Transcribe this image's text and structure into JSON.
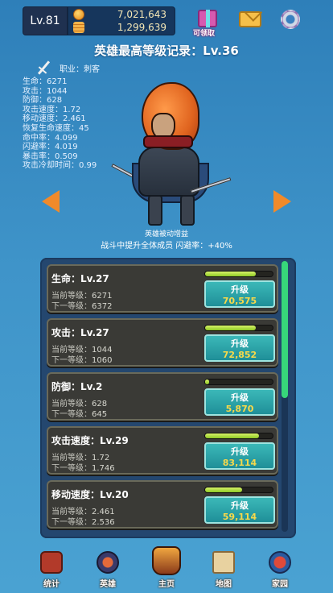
{
  "header": {
    "level": "Lv.81",
    "gold": "7,021,643",
    "gems": "1,299,639",
    "gift_label": "可领取"
  },
  "hero": {
    "record_title": "英雄最高等级记录：Lv.36",
    "job": "职业：刺客",
    "stats": [
      "生命：6271",
      "攻击：1044",
      "防御：628",
      "攻击速度：1.72",
      "移动速度：2.461",
      "恢复生命速度：45",
      "命中率：4.099",
      "闪避率：4.019",
      "暴击率：0.509",
      "攻击冷却时间：0.99"
    ],
    "passive_title": "英雄被动增益",
    "passive_desc": "战斗中提升全体成员 闪避率：+40%"
  },
  "upgrades": [
    {
      "name": "生命：Lv.27",
      "cur_label": "当前等级：",
      "cur": "6271",
      "next_label": "下一等级：",
      "next": "6372",
      "btn": "升级",
      "cost": "70,575",
      "progress": 0.75
    },
    {
      "name": "攻击：Lv.27",
      "cur_label": "当前等级：",
      "cur": "1044",
      "next_label": "下一等级：",
      "next": "1060",
      "btn": "升级",
      "cost": "72,852",
      "progress": 0.75
    },
    {
      "name": "防御：Lv.2",
      "cur_label": "当前等级：",
      "cur": "628",
      "next_label": "下一等级：",
      "next": "645",
      "btn": "升级",
      "cost": "5,870",
      "progress": 0.05
    },
    {
      "name": "攻击速度：Lv.29",
      "cur_label": "当前等级：",
      "cur": "1.72",
      "next_label": "下一等级：",
      "next": "1.746",
      "btn": "升级",
      "cost": "83,114",
      "progress": 0.8
    },
    {
      "name": "移动速度：Lv.20",
      "cur_label": "当前等级：",
      "cur": "2.461",
      "next_label": "下一等级：",
      "next": "2.536",
      "btn": "升级",
      "cost": "59,114",
      "progress": 0.55
    }
  ],
  "nav": [
    {
      "label": "统计",
      "icon": "stats-icon"
    },
    {
      "label": "英雄",
      "icon": "hero-icon"
    },
    {
      "label": "主页",
      "icon": "home-icon"
    },
    {
      "label": "地图",
      "icon": "map-icon"
    },
    {
      "label": "家园",
      "icon": "garden-icon"
    }
  ],
  "colors": {
    "background": "#3f94c9",
    "accent": "#f08a2a",
    "button": "#1f8f98",
    "cost": "#f7d94a",
    "progress": "#8ec824"
  }
}
